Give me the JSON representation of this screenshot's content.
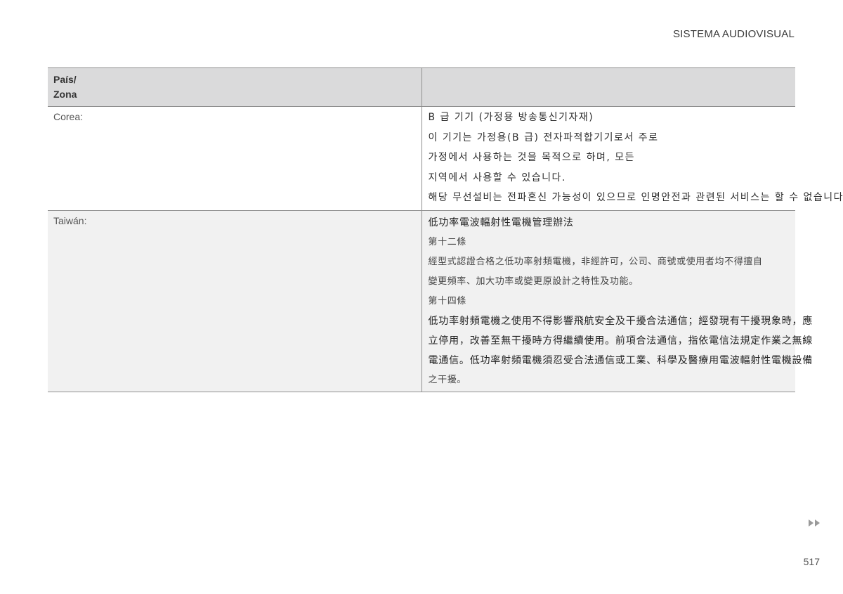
{
  "header": {
    "section_title": "SISTEMA AUDIOVISUAL"
  },
  "table": {
    "column_header": "País/\nZona",
    "rows": [
      {
        "country": "Corea:",
        "lines": [
          "B 급 기기 (가정용 방송통신기자재)",
          "이 기기는 가정용(B 급) 전자파적합기기로서 주로",
          "가정에서 사용하는 것을 목적으로 하며, 모든",
          "지역에서 사용할 수 있습니다.",
          "해당 무선설비는 전파혼신 가능성이 있으므로 인명안전과 관련된 서비스는 할 수 없습니다."
        ]
      },
      {
        "country": "Taiwán:",
        "lines": [
          "低功率電波輻射性電機管理辦法",
          "第十二條",
          "經型式認證合格之低功率射頻電機，非經許可，公司、商號或使用者均不得擅自",
          "變更頻率、加大功率或變更原設計之特性及功能。",
          "第十四條",
          "低功率射頻電機之使用不得影響飛航安全及干擾合法通信；經發現有干擾現象時，應",
          "立停用，改善至無干擾時方得繼續使用。前項合法通信，指依電信法規定作業之無線",
          "電通信。低功率射頻電機須忍受合法通信或工業、科學及醫療用電波輻射性電機設備",
          "之干擾。"
        ]
      }
    ]
  },
  "footer": {
    "next_page_icon": "double-triangle-right-icon",
    "page_number": "517"
  }
}
